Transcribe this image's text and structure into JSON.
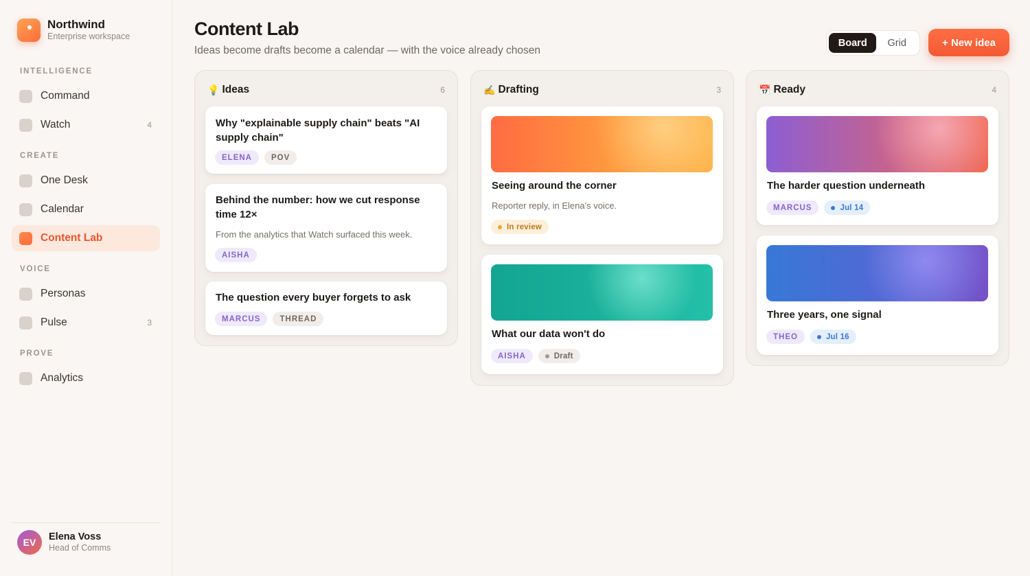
{
  "brand": {
    "name": "Northwind",
    "subtitle": "Enterprise workspace"
  },
  "sidebar": {
    "sections": [
      {
        "label": "INTELLIGENCE"
      },
      {
        "label": "CREATE"
      },
      {
        "label": "VOICE"
      },
      {
        "label": "PROVE"
      }
    ],
    "items": [
      {
        "label": "Command",
        "count": ""
      },
      {
        "label": "Watch",
        "count": "4"
      },
      {
        "label": "One Desk",
        "count": ""
      },
      {
        "label": "Calendar",
        "count": ""
      },
      {
        "label": "Content Lab",
        "count": "",
        "active": true
      },
      {
        "label": "Personas",
        "count": ""
      },
      {
        "label": "Pulse",
        "count": "3"
      },
      {
        "label": "Analytics",
        "count": ""
      }
    ]
  },
  "user": {
    "initials": "EV",
    "name": "Elena Voss",
    "role": "Head of Comms"
  },
  "header": {
    "title": "Content Lab",
    "subtitle": "Ideas become drafts become a calendar — with the voice already chosen",
    "view_toggle": {
      "board": "Board",
      "grid": "Grid",
      "selected": "Board"
    },
    "new_button": "+ New idea"
  },
  "colors": {
    "accent": "#f45a34",
    "active_bg": "#fde8de",
    "dark": "#221a16"
  },
  "columns": [
    {
      "icon": "💡",
      "icon_name": "lightbulb-icon",
      "title": "Ideas",
      "count": "6",
      "cards": [
        {
          "title": "Why \"explainable supply chain\" beats \"AI supply chain\"",
          "tags": [
            "ELENA",
            "POV"
          ]
        },
        {
          "title": "Behind the number: how we cut response time 12×",
          "desc": "From the analytics that Watch surfaced this week.",
          "tags": [
            "AISHA"
          ]
        },
        {
          "title": "The question every buyer forgets to ask",
          "tags": [
            "MARCUS",
            "THREAD"
          ]
        }
      ]
    },
    {
      "icon": "✍️",
      "icon_name": "writing-hand-icon",
      "title": "Drafting",
      "count": "3",
      "cards": [
        {
          "title": "Seeing around the corner",
          "desc": "Reporter reply, in Elena's voice.",
          "status": "In review"
        },
        {
          "title": "What our data won't do",
          "tags": [
            "AISHA"
          ],
          "status": "Draft"
        }
      ]
    },
    {
      "icon": "📅",
      "icon_name": "calendar-icon",
      "title": "Ready",
      "count": "4",
      "cards": [
        {
          "title": "The harder question underneath",
          "tags": [
            "MARCUS"
          ],
          "date": "Jul 14"
        },
        {
          "title": "Three years, one signal",
          "tags": [
            "THEO"
          ],
          "date": "Jul 16"
        }
      ]
    }
  ]
}
